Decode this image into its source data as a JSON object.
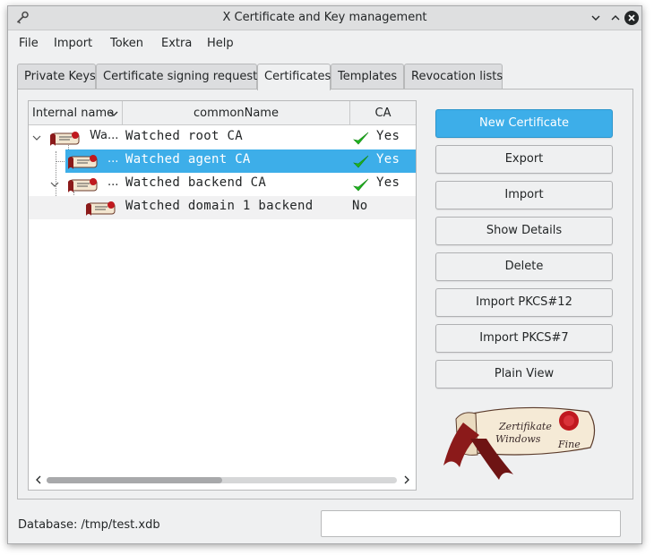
{
  "window": {
    "title": "X Certificate and Key management"
  },
  "menubar": {
    "items": [
      "File",
      "Import",
      "Token",
      "Extra",
      "Help"
    ]
  },
  "tabs": [
    "Private Keys",
    "Certificate signing requests",
    "Certificates",
    "Templates",
    "Revocation lists"
  ],
  "active_tab": "Certificates",
  "table": {
    "columns": [
      "Internal name",
      "commonName",
      "CA"
    ],
    "rows": [
      {
        "internal": "Wa...",
        "common": "Watched root CA",
        "ca": "Yes",
        "ca_check": true
      },
      {
        "internal": "...",
        "common": "Watched agent CA",
        "ca": "Yes",
        "ca_check": true,
        "selected": true
      },
      {
        "internal": "...",
        "common": "Watched backend CA",
        "ca": "Yes",
        "ca_check": true
      },
      {
        "internal": "",
        "common": "Watched domain 1 backend",
        "ca": "No",
        "ca_check": false
      }
    ]
  },
  "buttons": [
    "New Certificate",
    "Export",
    "Import",
    "Show Details",
    "Delete",
    "Import PKCS#12",
    "Import PKCS#7",
    "Plain View"
  ],
  "logo": {
    "line1": "Zertifikate",
    "line2": "Windows",
    "line3": "Fine"
  },
  "statusbar": {
    "text": "Database: /tmp/test.xdb"
  },
  "colors": {
    "accent": "#3daee9",
    "check": "#1fb51f",
    "seal": "#c0191f"
  }
}
